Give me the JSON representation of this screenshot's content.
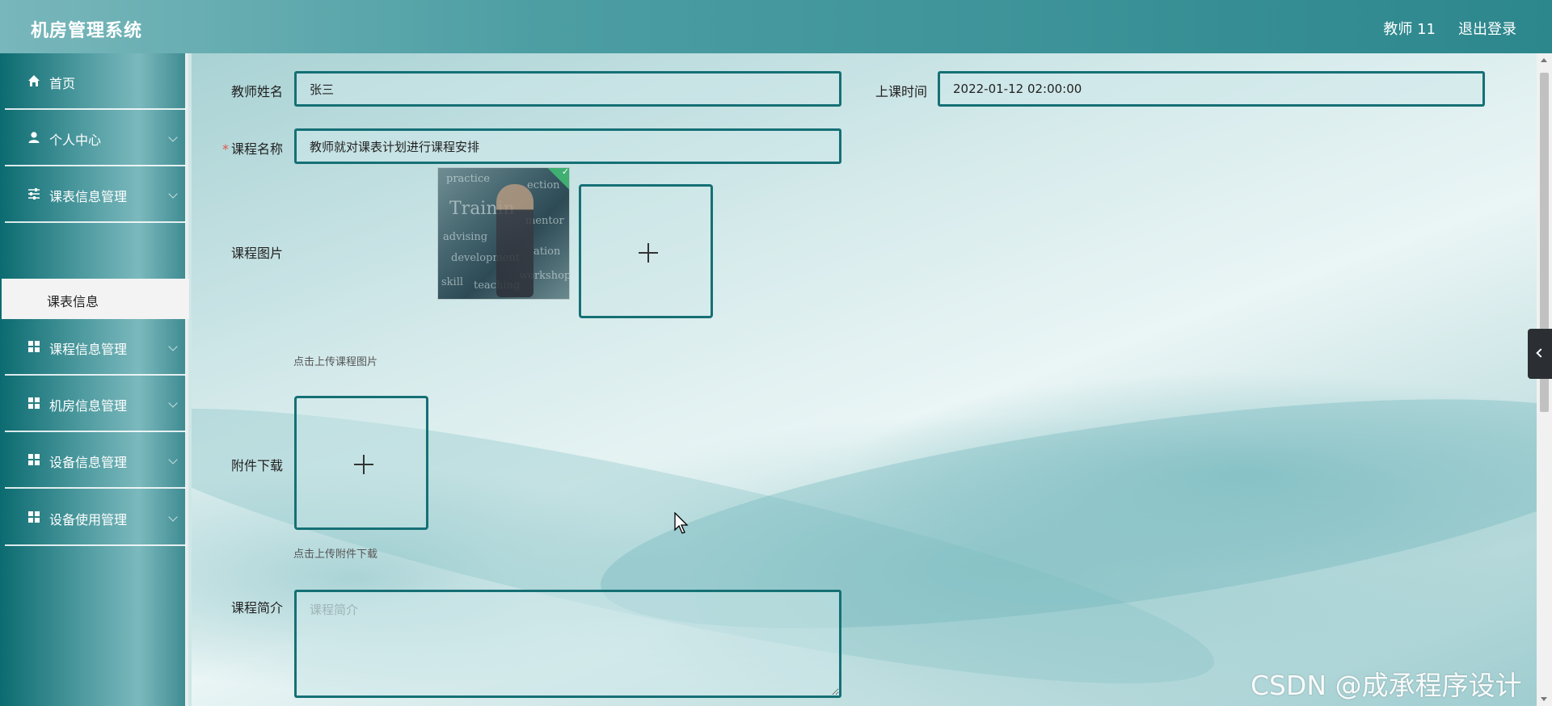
{
  "header": {
    "app_title": "机房管理系统",
    "user": "教师 11",
    "logout": "退出登录"
  },
  "sidebar": {
    "items": [
      {
        "label": "首页",
        "icon": "home-icon"
      },
      {
        "label": "个人中心",
        "icon": "user-icon"
      },
      {
        "label": "课表信息管理",
        "icon": "sliders-icon"
      },
      {
        "label": "课程信息管理",
        "icon": "grid-icon"
      },
      {
        "label": "机房信息管理",
        "icon": "grid-icon"
      },
      {
        "label": "设备信息管理",
        "icon": "grid-icon"
      },
      {
        "label": "设备使用管理",
        "icon": "grid-icon"
      }
    ],
    "active_subitem": "课表信息"
  },
  "form": {
    "teacher_name_label": "教师姓名",
    "teacher_name_value": "张三",
    "class_time_label": "上课时间",
    "class_time_value": "2022-01-12 02:00:00",
    "course_name_required": "*",
    "course_name_label": "课程名称",
    "course_name_value": "教师就对课表计划进行课程安排",
    "course_image_label": "课程图片",
    "course_image_hint": "点击上传课程图片",
    "attachment_label": "附件下载",
    "attachment_hint": "点击上传附件下载",
    "intro_label": "课程简介",
    "intro_placeholder": "课程简介",
    "image_board_words": [
      "practice",
      "ection",
      "Trainin",
      "mentor",
      "advising",
      "ation",
      "development",
      "workshop",
      "skill",
      "teaching"
    ]
  },
  "watermark": "CSDN @成承程序设计",
  "colors": {
    "header_start": "#78b7bb",
    "header_end": "#2c878d",
    "accent_border": "#157075",
    "sidebar_dark": "#0b6b70",
    "required": "#e2554a"
  }
}
